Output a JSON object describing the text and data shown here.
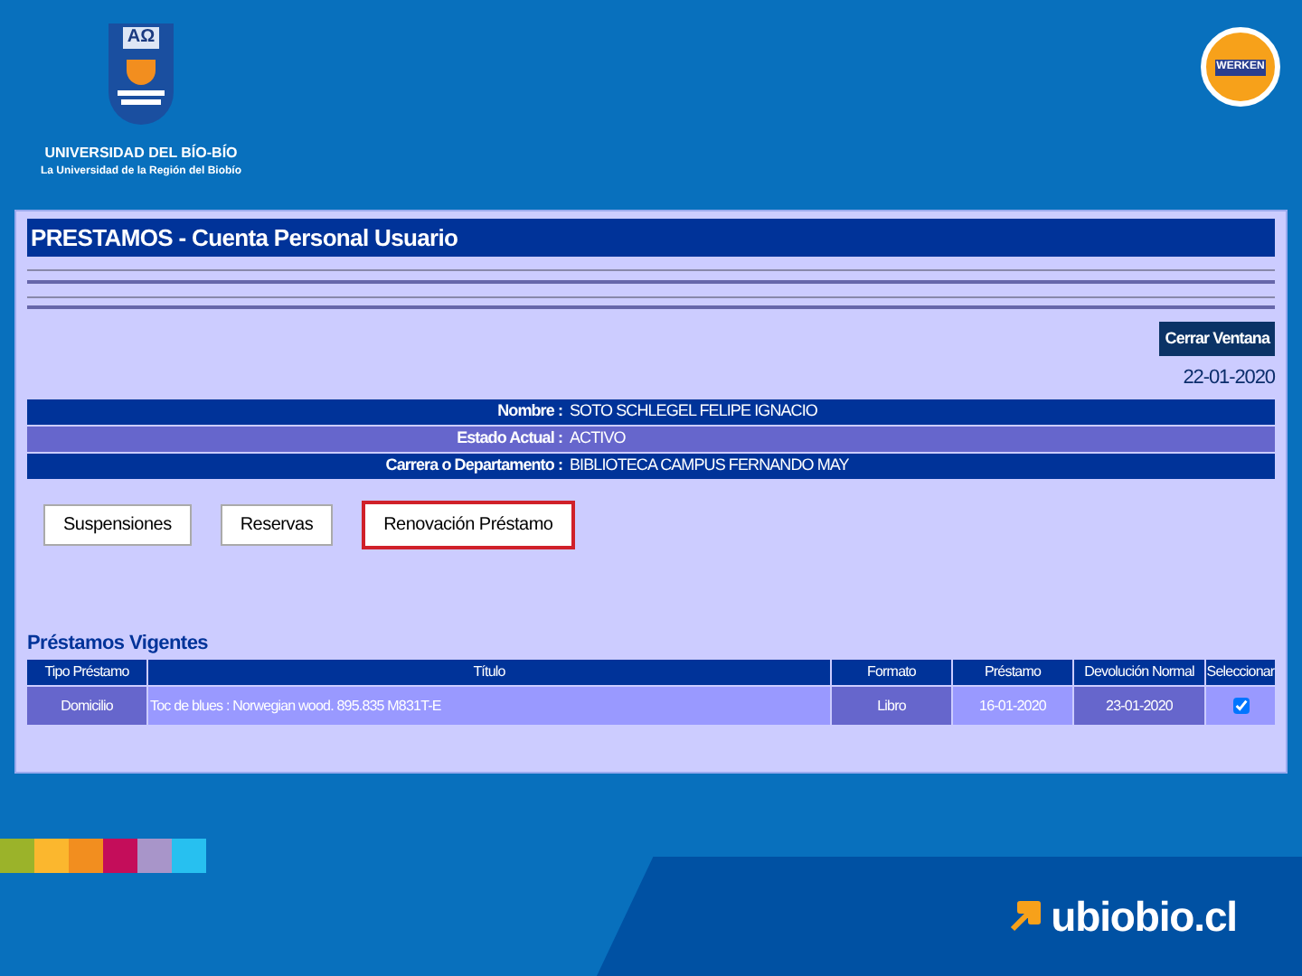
{
  "header": {
    "crest_letters": "AΩ",
    "university": "UNIVERSIDAD DEL BÍO-BÍO",
    "tagline": "La Universidad de la Región del Biobío",
    "badge": "WERKEN"
  },
  "page": {
    "title": "PRESTAMOS - Cuenta Personal Usuario",
    "close_button": "Cerrar Ventana",
    "date": "22-01-2020",
    "info": [
      {
        "label": "Nombre :",
        "value": "SOTO SCHLEGEL FELIPE IGNACIO"
      },
      {
        "label": "Estado Actual :",
        "value": "ACTIVO"
      },
      {
        "label": "Carrera o Departamento :",
        "value": "BIBLIOTECA CAMPUS FERNANDO MAY"
      }
    ],
    "buttons": [
      {
        "label": "Suspensiones",
        "selected": false
      },
      {
        "label": "Reservas",
        "selected": false
      },
      {
        "label": "Renovación Préstamo",
        "selected": true
      }
    ],
    "section_title": "Préstamos Vigentes",
    "table": {
      "columns": [
        "Tipo Préstamo",
        "Título",
        "Formato",
        "Préstamo",
        "Devolución Normal",
        "Seleccionar"
      ],
      "rows": [
        {
          "cells": [
            "Domicilio",
            "Toc de blues : Norwegian wood. 895.835 M831T-E",
            "Libro",
            "16-01-2020",
            "23-01-2020"
          ],
          "checked": true
        }
      ]
    }
  },
  "footer": {
    "swatches": [
      {
        "color": "#9bb32a"
      },
      {
        "color": "#fbb72e"
      },
      {
        "color": "#f28e1f"
      },
      {
        "color": "#c40d5a"
      },
      {
        "color": "#a895c9"
      },
      {
        "color": "#27c0f0"
      }
    ],
    "site": "ubiobio.cl"
  }
}
